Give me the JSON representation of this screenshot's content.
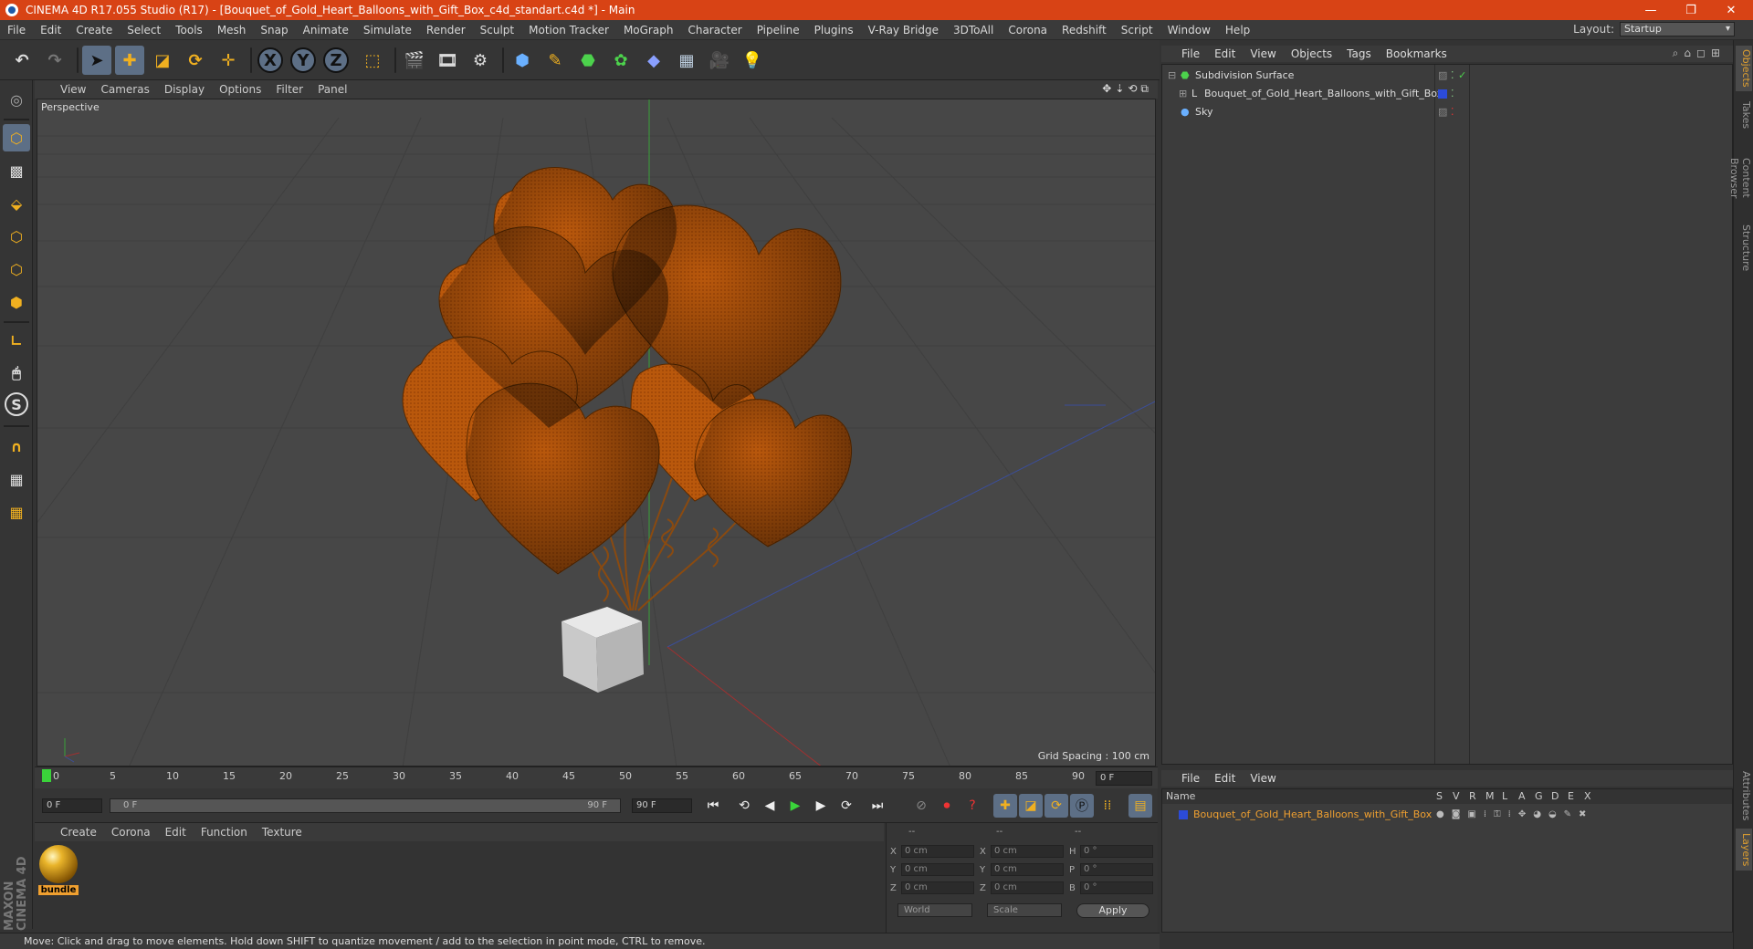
{
  "window": {
    "title": "CINEMA 4D R17.055 Studio (R17) - [Bouquet_of_Gold_Heart_Balloons_with_Gift_Box_c4d_standart.c4d *] - Main"
  },
  "menu": [
    "File",
    "Edit",
    "Create",
    "Select",
    "Tools",
    "Mesh",
    "Snap",
    "Animate",
    "Simulate",
    "Render",
    "Sculpt",
    "Motion Tracker",
    "MoGraph",
    "Character",
    "Pipeline",
    "Plugins",
    "V-Ray Bridge",
    "3DToAll",
    "Corona",
    "Redshift",
    "Script",
    "Window",
    "Help"
  ],
  "layout": {
    "label": "Layout:",
    "value": "Startup"
  },
  "viewport": {
    "menu": [
      "View",
      "Cameras",
      "Display",
      "Options",
      "Filter",
      "Panel"
    ],
    "label": "Perspective",
    "grid_spacing": "Grid Spacing : 100 cm"
  },
  "timeline": {
    "ticks": [
      "0",
      "5",
      "10",
      "15",
      "20",
      "25",
      "30",
      "35",
      "40",
      "45",
      "50",
      "55",
      "60",
      "65",
      "70",
      "75",
      "80",
      "85",
      "90"
    ],
    "current_frame": "0 F",
    "start_field": "0 F",
    "range_start": "0 F",
    "range_end": "90 F",
    "end_field": "90 F"
  },
  "material_manager": {
    "menu": [
      "Create",
      "Corona",
      "Edit",
      "Function",
      "Texture"
    ],
    "material_name": "bundle"
  },
  "coordinates": {
    "headers": [
      "--",
      "--",
      "--"
    ],
    "rows": [
      {
        "a": "X",
        "av": "0 cm",
        "b": "X",
        "bv": "0 cm",
        "c": "H",
        "cv": "0 °"
      },
      {
        "a": "Y",
        "av": "0 cm",
        "b": "Y",
        "bv": "0 cm",
        "c": "P",
        "cv": "0 °"
      },
      {
        "a": "Z",
        "av": "0 cm",
        "b": "Z",
        "bv": "0 cm",
        "c": "B",
        "cv": "0 °"
      }
    ],
    "mode": "World",
    "scale": "Scale",
    "apply": "Apply"
  },
  "status": "Move: Click and drag to move elements. Hold down SHIFT to quantize movement / add to the selection in point mode, CTRL to remove.",
  "brand": "MAXON CINEMA 4D",
  "object_manager": {
    "menu": [
      "File",
      "Edit",
      "View",
      "Objects",
      "Tags",
      "Bookmarks"
    ],
    "objects": [
      "Subdivision Surface",
      "Bouquet_of_Gold_Heart_Balloons_with_Gift_Box",
      "Sky"
    ]
  },
  "layer_manager": {
    "menu": [
      "File",
      "Edit",
      "View"
    ],
    "columns": [
      "Name",
      "S",
      "V",
      "R",
      "M",
      "L",
      "A",
      "G",
      "D",
      "E",
      "X"
    ],
    "layer": "Bouquet_of_Gold_Heart_Balloons_with_Gift_Box"
  },
  "side_tabs": [
    "Objects",
    "Takes",
    "Content Browser",
    "Structure",
    "Attributes",
    "Layers"
  ],
  "colors": {
    "accent": "#d84315",
    "selected": "#5d6f86",
    "balloon": "#b8560a",
    "layer_text": "#f0a030"
  }
}
